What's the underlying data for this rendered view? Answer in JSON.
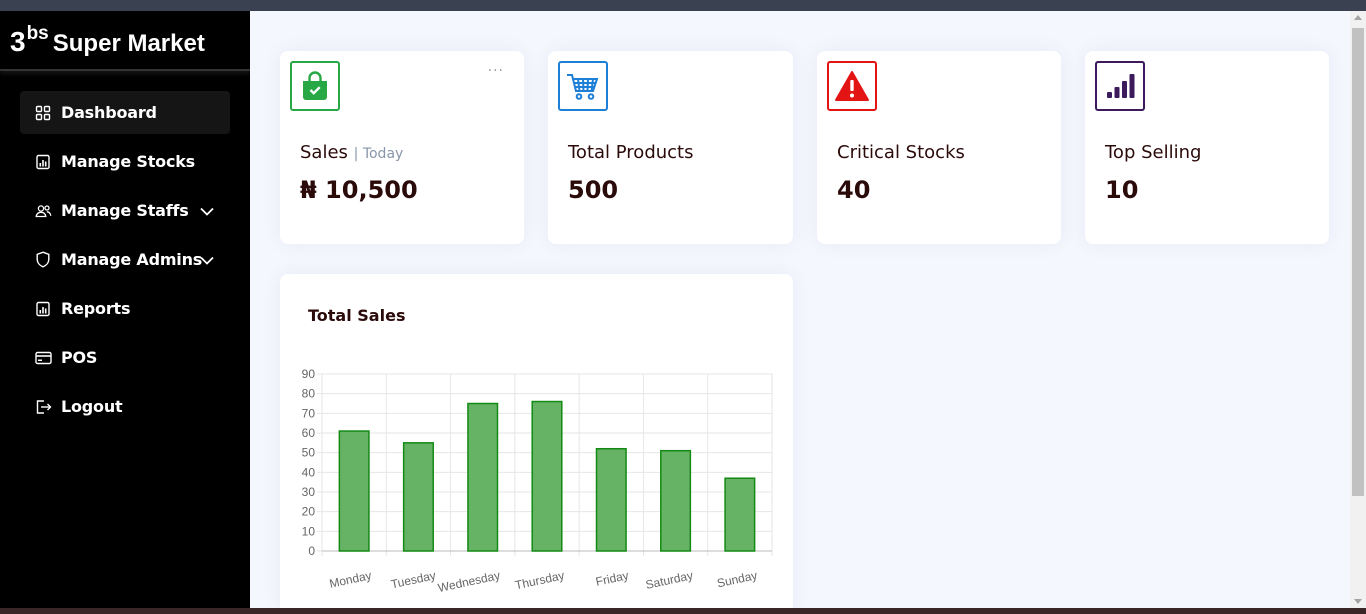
{
  "brand": {
    "num": "3",
    "sup": "bs",
    "name": "Super Market"
  },
  "nav": [
    {
      "label": "Dashboard",
      "icon": "grid-icon",
      "active": true
    },
    {
      "label": "Manage Stocks",
      "icon": "bar-report-icon"
    },
    {
      "label": "Manage Staffs",
      "icon": "people-icon",
      "expandable": true
    },
    {
      "label": "Manage Admins",
      "icon": "shield-icon",
      "expandable": true
    },
    {
      "label": "Reports",
      "icon": "bar-report-icon"
    },
    {
      "label": "POS",
      "icon": "card-icon"
    },
    {
      "label": "Logout",
      "icon": "logout-icon"
    }
  ],
  "cards": {
    "sales": {
      "title": "Sales",
      "sub": "| Today",
      "value": "₦ 10,500",
      "more": "···",
      "color": "#28a745"
    },
    "products": {
      "title": "Total Products",
      "value": "500",
      "color": "#1e7fd6"
    },
    "critical": {
      "title": "Critical Stocks",
      "value": "40",
      "color": "#e31414"
    },
    "top": {
      "title": "Top Selling",
      "value": "10",
      "color": "#3d1a5c"
    }
  },
  "sales_chart": {
    "title": "Total Sales"
  },
  "chart_data": {
    "type": "bar",
    "categories": [
      "Monday",
      "Tuesday",
      "Wednesday",
      "Thursday",
      "Friday",
      "Saturday",
      "Sunday"
    ],
    "values": [
      61,
      55,
      75,
      76,
      52,
      51,
      37
    ],
    "ylim": [
      0,
      90
    ],
    "yticks": [
      0,
      10,
      20,
      30,
      40,
      50,
      60,
      70,
      80,
      90
    ],
    "grid": true,
    "bar_fill": "#66b366",
    "bar_stroke": "#138a13",
    "title": "",
    "xlabel": "",
    "ylabel": ""
  }
}
